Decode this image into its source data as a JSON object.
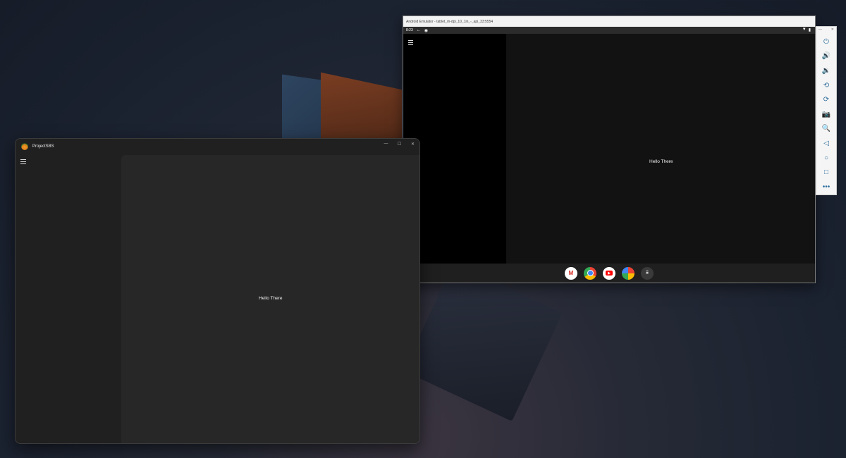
{
  "windows_app": {
    "title": "ProjectSBS",
    "controls": {
      "minimize": "—",
      "maximize": "☐",
      "close": "✕"
    },
    "content_text": "Hello There"
  },
  "emulator": {
    "title": "Android Emulator - tablet_m-dpi_10_1in_-_api_33:5554",
    "status": {
      "time": "8:23",
      "back_icon": "←",
      "notif_icon": "◉",
      "wifi_icon": "▼",
      "battery_icon": "▮"
    },
    "content_text": "Hello There",
    "dock": [
      {
        "name": "gmail",
        "glyph": "M"
      },
      {
        "name": "chrome",
        "glyph": ""
      },
      {
        "name": "youtube",
        "glyph": "▶"
      },
      {
        "name": "photos",
        "glyph": ""
      },
      {
        "name": "app-drawer",
        "glyph": "⠿"
      }
    ]
  },
  "emulator_toolbar": {
    "top_controls": {
      "minimize": "—",
      "close": "✕"
    },
    "buttons": [
      {
        "name": "power",
        "glyph": "⏻"
      },
      {
        "name": "volume-up",
        "glyph": "🔊"
      },
      {
        "name": "volume-down",
        "glyph": "🔉"
      },
      {
        "name": "rotate-left",
        "glyph": "⟲"
      },
      {
        "name": "rotate-right",
        "glyph": "⟳"
      },
      {
        "name": "screenshot",
        "glyph": "📷"
      },
      {
        "name": "zoom",
        "glyph": "🔍"
      },
      {
        "name": "back",
        "glyph": "◁"
      },
      {
        "name": "home",
        "glyph": "○"
      },
      {
        "name": "overview",
        "glyph": "□"
      },
      {
        "name": "more",
        "glyph": "•••"
      }
    ]
  }
}
